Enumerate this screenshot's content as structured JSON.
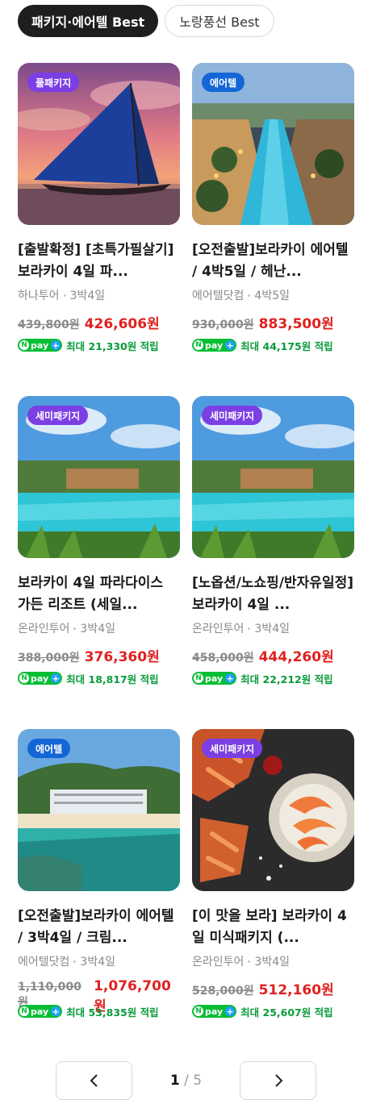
{
  "tabs": [
    {
      "label": "패키지·에어텔 Best",
      "active": true
    },
    {
      "label": "노랑풍선 Best",
      "active": false
    }
  ],
  "products": [
    {
      "badge": "풀패키지",
      "badge_color": "#7b3fe4",
      "image": "sailboat-sunset",
      "title": "[출발확정] [초특가필살기] 보라카이 4일 파...",
      "seller": "하나투어",
      "duration": "3박4일",
      "original_price": "439,800원",
      "sale_price": "426,606원",
      "npay_text": "최대 21,330원 적립"
    },
    {
      "badge": "에어텔",
      "badge_color": "#1466d6",
      "image": "resort-pool-night",
      "title": "[오전출발]보라카이 에어텔 / 4박5일 / 헤난...",
      "seller": "에어텔닷컴",
      "duration": "4박5일",
      "original_price": "930,000원",
      "sale_price": "883,500원",
      "npay_text": "최대 44,175원 적립"
    },
    {
      "badge": "세미패키지",
      "badge_color": "#7b3fe4",
      "image": "resort-pool-day",
      "title": "보라카이 4일 파라다이스 가든 리조트 (세일...",
      "seller": "온라인투어",
      "duration": "3박4일",
      "original_price": "388,000원",
      "sale_price": "376,360원",
      "npay_text": "최대 18,817원 적립"
    },
    {
      "badge": "세미패키지",
      "badge_color": "#7b3fe4",
      "image": "resort-pool-day",
      "title": "[노옵션/노쇼핑/반자유일정] 보라카이 4일 ...",
      "seller": "온라인투어",
      "duration": "3박4일",
      "original_price": "458,000원",
      "sale_price": "444,260원",
      "npay_text": "최대 22,212원 적립"
    },
    {
      "badge": "에어텔",
      "badge_color": "#1466d6",
      "image": "beach-hotel-aerial",
      "title": "[오전출발]보라카이 에어텔 / 3박4일 / 크림...",
      "seller": "에어텔닷컴",
      "duration": "3박4일",
      "original_price": "1,110,000원",
      "sale_price": "1,076,700원",
      "npay_text": "최대 53,835원 적립"
    },
    {
      "badge": "세미패키지",
      "badge_color": "#7b3fe4",
      "image": "seafood-shrimp",
      "title": "[이 맛을 보라] 보라카이 4일 미식패키지 (...",
      "seller": "온라인투어",
      "duration": "3박4일",
      "original_price": "528,000원",
      "sale_price": "512,160원",
      "npay_text": "최대 25,607원 적립"
    }
  ],
  "npay_logo": {
    "n": "N",
    "text": "pay",
    "plus": "+"
  },
  "pagination": {
    "current": "1",
    "separator": "/",
    "total": "5",
    "prev_icon": "chevron-left-icon",
    "next_icon": "chevron-right-icon"
  }
}
